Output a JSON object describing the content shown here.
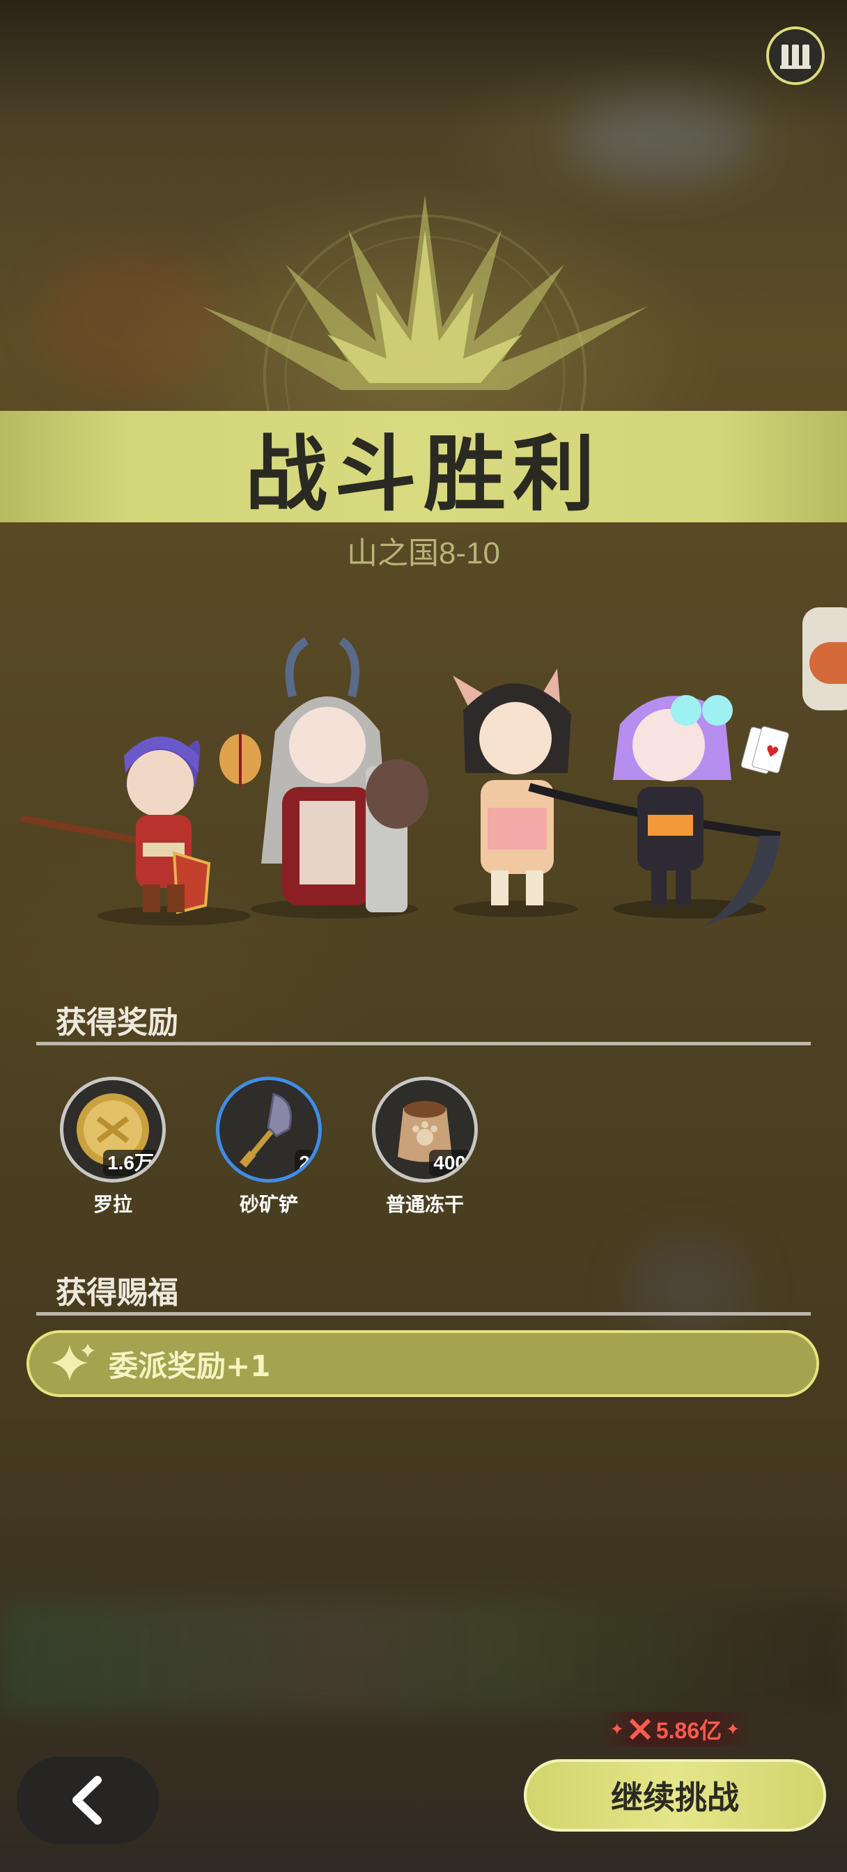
{
  "banner": {
    "title": "战斗胜利",
    "stage": "山之国8-10"
  },
  "rewards_section": {
    "title": "获得奖励",
    "items": [
      {
        "name": "罗拉",
        "qty": "1.6万",
        "icon": "gold-coin-icon",
        "rarity": "normal"
      },
      {
        "name": "砂矿铲",
        "qty": "2",
        "icon": "shovel-icon",
        "rarity": "blue"
      },
      {
        "name": "普通冻干",
        "qty": "400",
        "icon": "food-sack-icon",
        "rarity": "normal"
      }
    ]
  },
  "blessing_section": {
    "title": "获得赐福",
    "item": {
      "label": "委派奖励+1",
      "icon": "sparkle-icon"
    }
  },
  "footer": {
    "power_value": "5.86亿",
    "continue_label": "继续挑战"
  },
  "colors": {
    "accent": "#d8da80",
    "power": "#ff5b4e"
  }
}
